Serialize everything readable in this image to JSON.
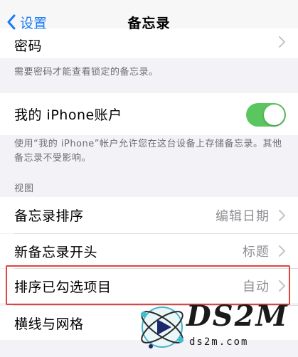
{
  "nav": {
    "back_label": "设置",
    "title": "备忘录"
  },
  "password_row": {
    "label": "密码"
  },
  "password_footnote": "需要密码才能查看锁定的备忘录。",
  "iphone_account": {
    "label": "我的 iPhone账户",
    "toggle_on": true
  },
  "iphone_footnote": "使用“我的 iPhone”帐户允许您在这台设备上存储备忘录。其他备忘录不受影响。",
  "view_section": {
    "header": "视图",
    "items": [
      {
        "label": "备忘录排序",
        "value": "编辑日期"
      },
      {
        "label": "新备忘录开头",
        "value": "标题"
      },
      {
        "label": "排序已勾选项目",
        "value": "自动"
      },
      {
        "label": "横线与网格",
        "value": ""
      }
    ]
  },
  "watermark": {
    "brand": "DS2M",
    "url": "ds2m.com"
  },
  "colors": {
    "accent": "#1a7cf5",
    "toggle": "#5bc65f",
    "highlight": "#e0443e"
  }
}
